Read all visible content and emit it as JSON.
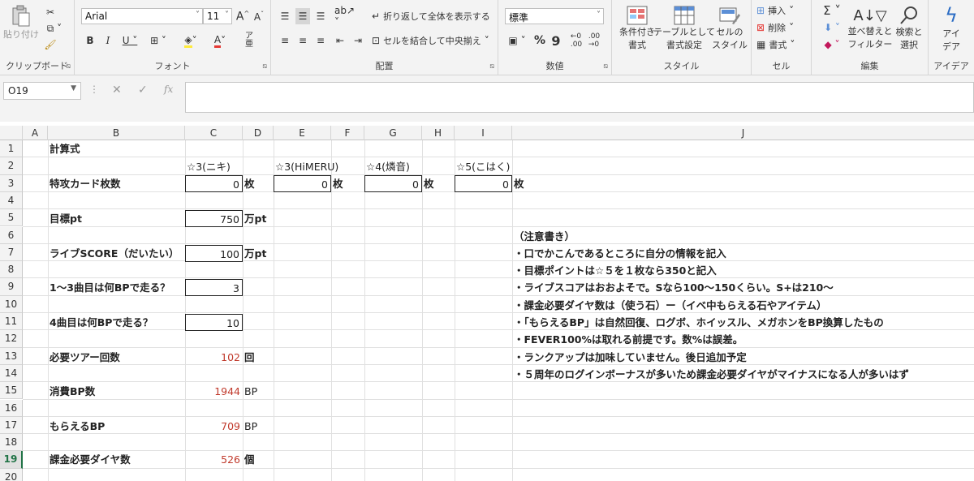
{
  "ribbon": {
    "clipboard": {
      "paste": "貼り付け",
      "label": "クリップボード"
    },
    "font": {
      "name": "Arial",
      "size": "11",
      "label": "フォント"
    },
    "alignment": {
      "wrap": "折り返して全体を表示する",
      "merge": "セルを結合して中央揃え",
      "label": "配置"
    },
    "number": {
      "format": "標準",
      "label": "数値"
    },
    "styles": {
      "cond_line1": "条件付き",
      "cond_line2": "書式",
      "table_line1": "テーブルとして",
      "table_line2": "書式設定",
      "cell_line1": "セルの",
      "cell_line2": "スタイル",
      "label": "スタイル"
    },
    "cells": {
      "insert": "挿入",
      "delete": "削除",
      "format": "書式",
      "label": "セル"
    },
    "editing": {
      "sort_line1": "並べ替えと",
      "sort_line2": "フィルター",
      "find_line1": "検索と",
      "find_line2": "選択",
      "label": "編集"
    },
    "ideas": {
      "line1": "アイ",
      "line2": "デア",
      "label": "アイデア"
    }
  },
  "formula_bar": {
    "name_box": "O19",
    "fx": "fx"
  },
  "columns": [
    "A",
    "B",
    "C",
    "D",
    "E",
    "F",
    "G",
    "H",
    "I",
    "J"
  ],
  "rows": [
    "1",
    "2",
    "3",
    "4",
    "5",
    "6",
    "7",
    "8",
    "9",
    "10",
    "11",
    "12",
    "13",
    "14",
    "15",
    "16",
    "17",
    "18",
    "19",
    "20"
  ],
  "selected_row": "19",
  "sheet": {
    "title": "計算式",
    "headers": {
      "c": "☆3(ニキ)",
      "e": "☆3(HiMERU)",
      "g": "☆4(燐音)",
      "i": "☆5(こはく)"
    },
    "card_count": {
      "label": "特攻カード枚数",
      "c": "0",
      "e": "0",
      "g": "0",
      "i": "0",
      "unit": "枚"
    },
    "target_pt": {
      "label": "目標pt",
      "value": "750",
      "unit": "万pt"
    },
    "live_score": {
      "label": "ライブSCORE（だいたい）",
      "value": "100",
      "unit": "万pt"
    },
    "bp_1_3": {
      "label": "1～3曲目は何BPで走る？",
      "value": "3"
    },
    "bp_4": {
      "label": "4曲目は何BPで走る？",
      "value": "10"
    },
    "tours": {
      "label": "必要ツアー回数",
      "value": "102",
      "unit": "回"
    },
    "bp_used": {
      "label": "消費BP数",
      "value": "1944",
      "unit": "BP"
    },
    "bp_get": {
      "label": "もらえるBP",
      "value": "709",
      "unit": "BP"
    },
    "diamonds": {
      "label": "課金必要ダイヤ数",
      "value": "526",
      "unit": "個"
    },
    "notes": [
      "（注意書き）",
      "・口でかこんであるところに自分の情報を記入",
      "・目標ポイントは☆５を１枚なら350と記入",
      "・ライブスコアはおおよそで。Sなら100～150くらい。S+は210～",
      "・課金必要ダイヤ数は（使う石）ー（イベ中もらえる石やアイテム）",
      "・「もらえるBP」は自然回復、ログボ、ホイッスル、メガホンをBP換算したもの",
      "・FEVER100%は取れる前提です。数%は誤差。",
      "・ランクアップは加味していません。後日追加予定",
      "・５周年のログインボーナスが多いため課金必要ダイヤがマイナスになる人が多いはず"
    ]
  },
  "colors": {
    "accent": "#217346",
    "result_red": "#c0392b"
  }
}
